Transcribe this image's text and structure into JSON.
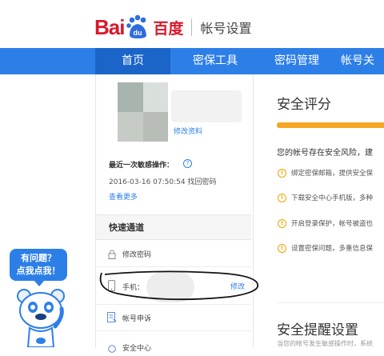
{
  "header": {
    "logo_bai": "Bai",
    "logo_du": "du",
    "logo_cn": "百度",
    "page_title": "帐号设置"
  },
  "nav": {
    "items": [
      {
        "label": "首页",
        "active": true
      },
      {
        "label": "密保工具",
        "active": false
      },
      {
        "label": "密码管理",
        "active": false
      },
      {
        "label": "帐号关",
        "active": false
      }
    ]
  },
  "profile": {
    "edit_label": "修改资料"
  },
  "recent": {
    "label": "最近一次敏感操作：",
    "time": "2016-03-16 07:50:54  找回密码",
    "view_more": "查看更多"
  },
  "quick": {
    "title": "快速通道",
    "items": [
      {
        "icon": "lock-icon",
        "label": "修改密码"
      },
      {
        "icon": "phone-icon",
        "label": "手机：",
        "action": "修改"
      },
      {
        "icon": "document-icon",
        "label": "帐号申诉"
      },
      {
        "icon": "item-icon",
        "label": "安全中心"
      }
    ]
  },
  "security": {
    "score_title": "安全评分",
    "risk_text": "您的帐号存在安全风险，建",
    "suggestions": [
      "绑定密保邮箱，提供安全保",
      "下载安全中心手机版，多种",
      "开启登录保护，帐号被盗也",
      "设置密保问题，多重信息保"
    ],
    "reminder_title": "安全提醒设置",
    "reminder_sub": "当您的帐号发生敏感操作时，系统"
  },
  "help_bubble": {
    "line1": "有问题？",
    "line2": "点我点我！"
  },
  "colors": {
    "brand_red": "#d8182b",
    "nav_blue": "#2d7fe8",
    "nav_active": "#1b64c8",
    "score_bar": "#f6a623"
  }
}
